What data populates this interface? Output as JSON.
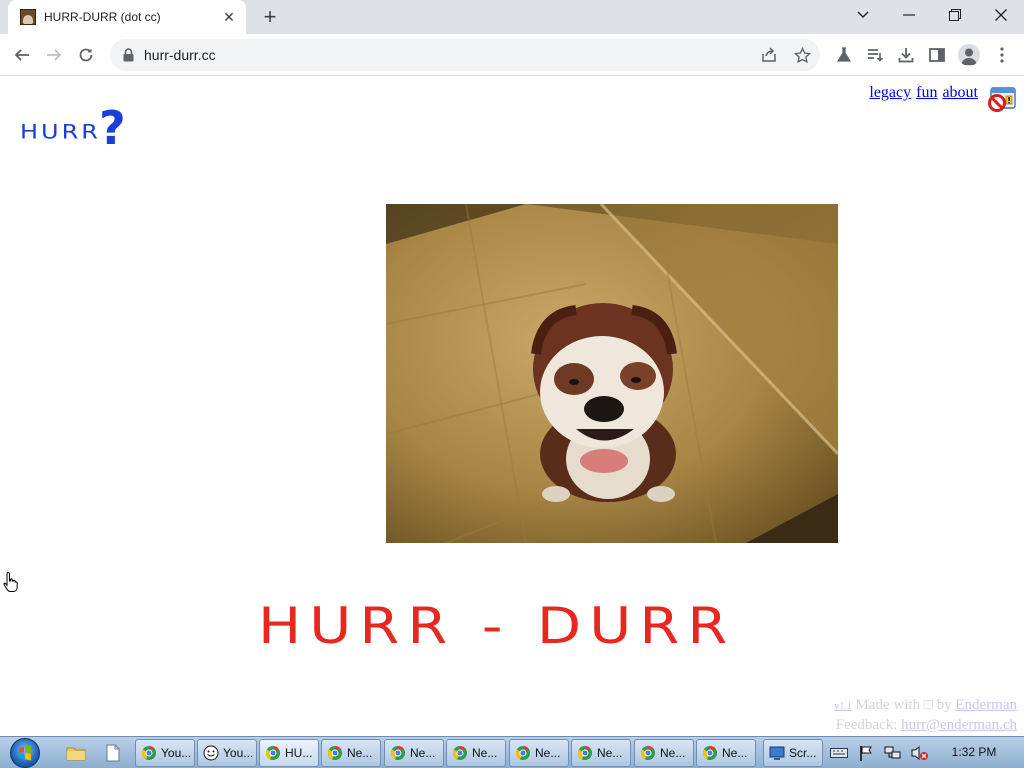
{
  "browser": {
    "tab": {
      "title": "HURR-DURR (dot cc)",
      "close_glyph": "✕"
    },
    "new_tab_glyph": "+",
    "url": "hurr-durr.cc",
    "window_controls": [
      "chevron-down-icon",
      "minimize-icon",
      "restore-icon",
      "close-icon"
    ]
  },
  "page": {
    "logo": {
      "text": "HURR",
      "mark": "?"
    },
    "nav_links": [
      {
        "label": "legacy"
      },
      {
        "label": "fun"
      },
      {
        "label": "about"
      }
    ],
    "image_alt": "bulldog",
    "headline": "HURR - DURR",
    "footer": {
      "version": "v1.1",
      "made_with": "Made with",
      "heart": "□",
      "by": "by",
      "author": "Enderman",
      "feedback_label": "Feedback:",
      "feedback_email": "hurr@enderman.ch"
    }
  },
  "taskbar": {
    "buttons": [
      {
        "label": "You...",
        "icon": "chrome-icon"
      },
      {
        "label": "You...",
        "icon": "smiley-icon"
      },
      {
        "label": "HU...",
        "icon": "chrome-icon",
        "active": true
      },
      {
        "label": "Ne...",
        "icon": "chrome-icon"
      },
      {
        "label": "Ne...",
        "icon": "chrome-icon"
      },
      {
        "label": "Ne...",
        "icon": "chrome-icon"
      },
      {
        "label": "Ne...",
        "icon": "chrome-icon"
      },
      {
        "label": "Ne...",
        "icon": "chrome-icon"
      },
      {
        "label": "Ne...",
        "icon": "chrome-icon"
      },
      {
        "label": "Ne...",
        "icon": "chrome-icon"
      },
      {
        "label": "Scr...",
        "icon": "monitor-icon"
      }
    ],
    "clock": "1:32 PM"
  },
  "colors": {
    "logo": "#1a3fd6",
    "headline": "#e8281e",
    "link": "#0000ee"
  }
}
